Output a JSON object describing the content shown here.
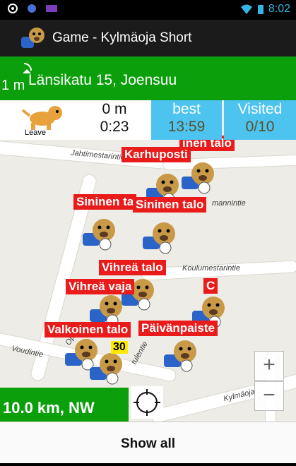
{
  "status": {
    "time": "8:02"
  },
  "title": "Game - Kylmäoja Short",
  "location": {
    "distance": "1 m",
    "address": "Länsikatu 15, Joensuu"
  },
  "stats": {
    "leave_label": "Leave",
    "distance": "0 m",
    "elapsed": "0:23",
    "best_label": "best",
    "best_value": "13:59",
    "visited_label": "Visited",
    "visited_value": "0/10"
  },
  "map": {
    "streets": [
      "Jahtimestarintie",
      "Koulumestarintie",
      "Voudintie",
      "mannintie",
      "Kylmäoja",
      "Oppi",
      "tulentie"
    ],
    "labels": [
      "Karhuposti",
      "inen talo",
      "Sininen ta",
      "Sininen talo",
      "Vihreä talo",
      "Vihreä vaja",
      "C",
      "Valkoinen talo",
      "Päivänpaiste"
    ],
    "badge": "30"
  },
  "zoom": {
    "in": "+",
    "out": "−"
  },
  "heading": "10.0 km, NW",
  "show_all": "Show all",
  "colors": {
    "green": "#0c9f0c",
    "blue": "#4dc3f0",
    "red": "#ea1b1b"
  }
}
